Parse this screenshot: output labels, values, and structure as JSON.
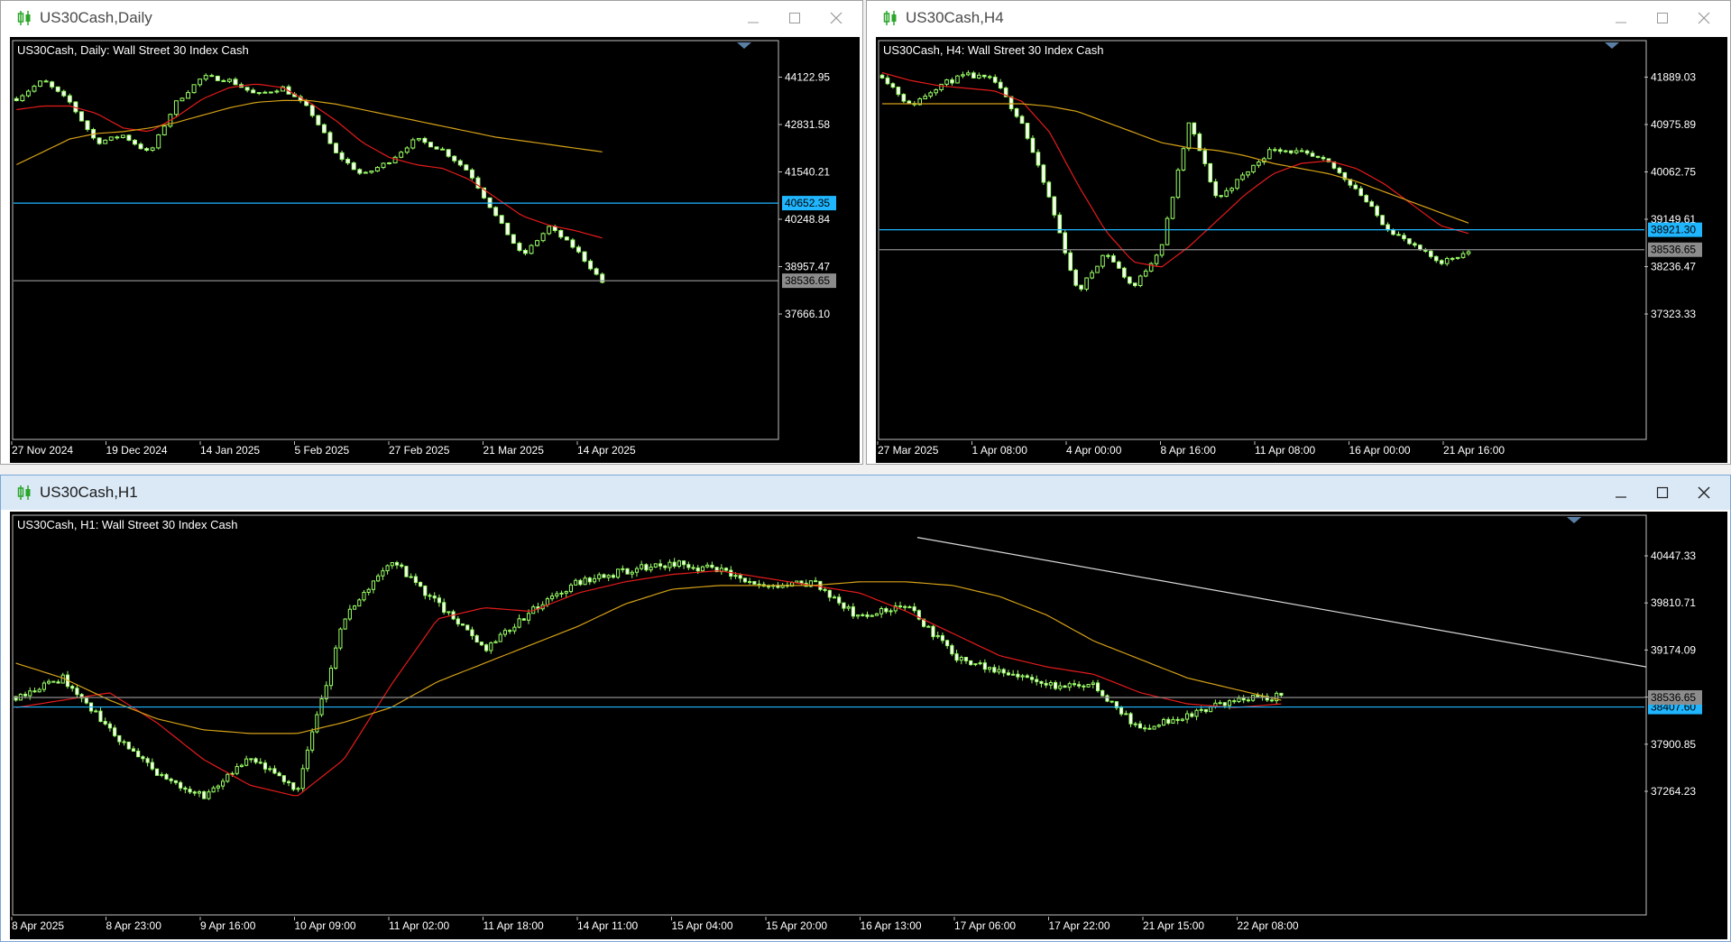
{
  "colors": {
    "background": "#000000",
    "frame": "#c0c0c0",
    "bull": "#9aff66",
    "bear": "#ffffff",
    "wick": "#9aff66",
    "fast_ma": "#e51b1b",
    "slow_ma": "#d4a017",
    "support": "#1fb6ff",
    "bid_line": "#8c8c8c",
    "trendline": "#d8d8d8",
    "text": "#ffffff"
  },
  "windows": [
    {
      "id": "daily",
      "title": "US30Cash,Daily",
      "chart_label": "US30Cash, Daily:  Wall Street 30 Index Cash",
      "icon": "candlestick-chart-icon",
      "controls": [
        "minimize-icon",
        "maximize-icon",
        "close-icon"
      ],
      "price_labels": [
        "44122.95",
        "42831.58",
        "41540.21",
        "40248.84",
        "38957.47",
        "37666.10"
      ],
      "time_labels": [
        "27 Nov 2024",
        "19 Dec 2024",
        "14 Jan 2025",
        "5 Feb 2025",
        "27 Feb 2025",
        "21 Mar 2025",
        "14 Apr 2025"
      ],
      "hline_support": {
        "value": 40652.35,
        "label": "40652.35"
      },
      "hline_bid": {
        "value": 38536.65,
        "label": "38536.65"
      }
    },
    {
      "id": "h4",
      "title": "US30Cash,H4",
      "chart_label": "US30Cash, H4:  Wall Street 30 Index Cash",
      "icon": "candlestick-chart-icon",
      "controls": [
        "minimize-icon",
        "maximize-icon",
        "close-icon"
      ],
      "price_labels": [
        "41889.03",
        "40975.89",
        "40062.75",
        "39149.61",
        "38236.47",
        "37323.33"
      ],
      "time_labels": [
        "27 Mar 2025",
        "1 Apr 08:00",
        "4 Apr 00:00",
        "8 Apr 16:00",
        "11 Apr 08:00",
        "16 Apr 00:00",
        "21 Apr 16:00"
      ],
      "hline_support": {
        "value": 38921.3,
        "label": "38921.30"
      },
      "hline_bid": {
        "value": 38536.65,
        "label": "38536.65"
      }
    },
    {
      "id": "h1",
      "title": "US30Cash,H1",
      "chart_label": "US30Cash, H1:  Wall Street 30 Index Cash",
      "icon": "candlestick-chart-icon",
      "controls": [
        "minimize-icon",
        "maximize-icon",
        "close-icon"
      ],
      "price_labels": [
        "40447.33",
        "39810.71",
        "39174.09",
        "38536.65",
        "37900.85",
        "37264.23"
      ],
      "time_labels": [
        "8 Apr 2025",
        "8 Apr 23:00",
        "9 Apr 16:00",
        "10 Apr 09:00",
        "11 Apr 02:00",
        "11 Apr 18:00",
        "14 Apr 11:00",
        "15 Apr 04:00",
        "15 Apr 20:00",
        "16 Apr 13:00",
        "17 Apr 06:00",
        "17 Apr 22:00",
        "21 Apr 15:00",
        "22 Apr 08:00"
      ],
      "hline_support": {
        "value": 38407.6,
        "label": "38407.60"
      },
      "hline_bid": {
        "value": 38536.65,
        "label": "38536.65"
      }
    }
  ]
}
